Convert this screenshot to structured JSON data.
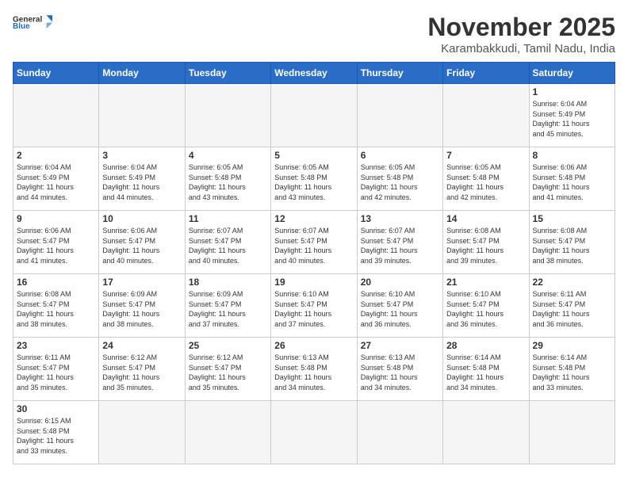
{
  "logo": {
    "general": "General",
    "blue": "Blue"
  },
  "title": "November 2025",
  "subtitle": "Karambakkudi, Tamil Nadu, India",
  "weekdays": [
    "Sunday",
    "Monday",
    "Tuesday",
    "Wednesday",
    "Thursday",
    "Friday",
    "Saturday"
  ],
  "weeks": [
    [
      {
        "day": "",
        "info": ""
      },
      {
        "day": "",
        "info": ""
      },
      {
        "day": "",
        "info": ""
      },
      {
        "day": "",
        "info": ""
      },
      {
        "day": "",
        "info": ""
      },
      {
        "day": "",
        "info": ""
      },
      {
        "day": "1",
        "info": "Sunrise: 6:04 AM\nSunset: 5:49 PM\nDaylight: 11 hours\nand 45 minutes."
      }
    ],
    [
      {
        "day": "2",
        "info": "Sunrise: 6:04 AM\nSunset: 5:49 PM\nDaylight: 11 hours\nand 44 minutes."
      },
      {
        "day": "3",
        "info": "Sunrise: 6:04 AM\nSunset: 5:49 PM\nDaylight: 11 hours\nand 44 minutes."
      },
      {
        "day": "4",
        "info": "Sunrise: 6:05 AM\nSunset: 5:48 PM\nDaylight: 11 hours\nand 43 minutes."
      },
      {
        "day": "5",
        "info": "Sunrise: 6:05 AM\nSunset: 5:48 PM\nDaylight: 11 hours\nand 43 minutes."
      },
      {
        "day": "6",
        "info": "Sunrise: 6:05 AM\nSunset: 5:48 PM\nDaylight: 11 hours\nand 42 minutes."
      },
      {
        "day": "7",
        "info": "Sunrise: 6:05 AM\nSunset: 5:48 PM\nDaylight: 11 hours\nand 42 minutes."
      },
      {
        "day": "8",
        "info": "Sunrise: 6:06 AM\nSunset: 5:48 PM\nDaylight: 11 hours\nand 41 minutes."
      }
    ],
    [
      {
        "day": "9",
        "info": "Sunrise: 6:06 AM\nSunset: 5:47 PM\nDaylight: 11 hours\nand 41 minutes."
      },
      {
        "day": "10",
        "info": "Sunrise: 6:06 AM\nSunset: 5:47 PM\nDaylight: 11 hours\nand 40 minutes."
      },
      {
        "day": "11",
        "info": "Sunrise: 6:07 AM\nSunset: 5:47 PM\nDaylight: 11 hours\nand 40 minutes."
      },
      {
        "day": "12",
        "info": "Sunrise: 6:07 AM\nSunset: 5:47 PM\nDaylight: 11 hours\nand 40 minutes."
      },
      {
        "day": "13",
        "info": "Sunrise: 6:07 AM\nSunset: 5:47 PM\nDaylight: 11 hours\nand 39 minutes."
      },
      {
        "day": "14",
        "info": "Sunrise: 6:08 AM\nSunset: 5:47 PM\nDaylight: 11 hours\nand 39 minutes."
      },
      {
        "day": "15",
        "info": "Sunrise: 6:08 AM\nSunset: 5:47 PM\nDaylight: 11 hours\nand 38 minutes."
      }
    ],
    [
      {
        "day": "16",
        "info": "Sunrise: 6:08 AM\nSunset: 5:47 PM\nDaylight: 11 hours\nand 38 minutes."
      },
      {
        "day": "17",
        "info": "Sunrise: 6:09 AM\nSunset: 5:47 PM\nDaylight: 11 hours\nand 38 minutes."
      },
      {
        "day": "18",
        "info": "Sunrise: 6:09 AM\nSunset: 5:47 PM\nDaylight: 11 hours\nand 37 minutes."
      },
      {
        "day": "19",
        "info": "Sunrise: 6:10 AM\nSunset: 5:47 PM\nDaylight: 11 hours\nand 37 minutes."
      },
      {
        "day": "20",
        "info": "Sunrise: 6:10 AM\nSunset: 5:47 PM\nDaylight: 11 hours\nand 36 minutes."
      },
      {
        "day": "21",
        "info": "Sunrise: 6:10 AM\nSunset: 5:47 PM\nDaylight: 11 hours\nand 36 minutes."
      },
      {
        "day": "22",
        "info": "Sunrise: 6:11 AM\nSunset: 5:47 PM\nDaylight: 11 hours\nand 36 minutes."
      }
    ],
    [
      {
        "day": "23",
        "info": "Sunrise: 6:11 AM\nSunset: 5:47 PM\nDaylight: 11 hours\nand 35 minutes."
      },
      {
        "day": "24",
        "info": "Sunrise: 6:12 AM\nSunset: 5:47 PM\nDaylight: 11 hours\nand 35 minutes."
      },
      {
        "day": "25",
        "info": "Sunrise: 6:12 AM\nSunset: 5:47 PM\nDaylight: 11 hours\nand 35 minutes."
      },
      {
        "day": "26",
        "info": "Sunrise: 6:13 AM\nSunset: 5:48 PM\nDaylight: 11 hours\nand 34 minutes."
      },
      {
        "day": "27",
        "info": "Sunrise: 6:13 AM\nSunset: 5:48 PM\nDaylight: 11 hours\nand 34 minutes."
      },
      {
        "day": "28",
        "info": "Sunrise: 6:14 AM\nSunset: 5:48 PM\nDaylight: 11 hours\nand 34 minutes."
      },
      {
        "day": "29",
        "info": "Sunrise: 6:14 AM\nSunset: 5:48 PM\nDaylight: 11 hours\nand 33 minutes."
      }
    ],
    [
      {
        "day": "30",
        "info": "Sunrise: 6:15 AM\nSunset: 5:48 PM\nDaylight: 11 hours\nand 33 minutes."
      },
      {
        "day": "",
        "info": ""
      },
      {
        "day": "",
        "info": ""
      },
      {
        "day": "",
        "info": ""
      },
      {
        "day": "",
        "info": ""
      },
      {
        "day": "",
        "info": ""
      },
      {
        "day": "",
        "info": ""
      }
    ]
  ]
}
